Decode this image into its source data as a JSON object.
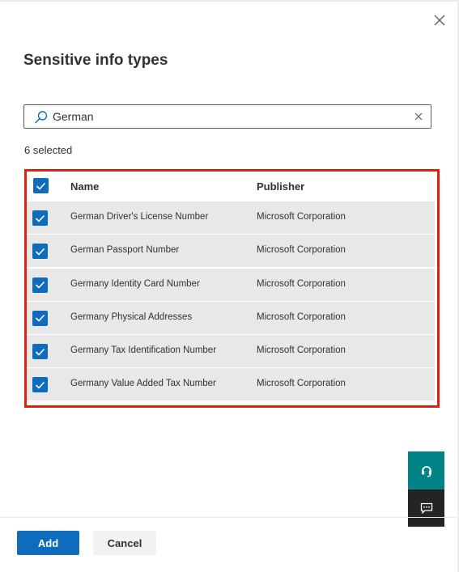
{
  "panel": {
    "title": "Sensitive info types",
    "close_icon": "close-icon"
  },
  "search": {
    "value": "German",
    "placeholder": "Search",
    "search_icon": "search-icon",
    "clear_icon": "clear-icon"
  },
  "selection": {
    "count_text": "6 selected"
  },
  "table": {
    "columns": {
      "name": "Name",
      "publisher": "Publisher"
    },
    "select_all_checked": true,
    "rows": [
      {
        "name": "German Driver's License Number",
        "publisher": "Microsoft Corporation",
        "checked": true
      },
      {
        "name": "German Passport Number",
        "publisher": "Microsoft Corporation",
        "checked": true
      },
      {
        "name": "Germany Identity Card Number",
        "publisher": "Microsoft Corporation",
        "checked": true
      },
      {
        "name": "Germany Physical Addresses",
        "publisher": "Microsoft Corporation",
        "checked": true
      },
      {
        "name": "Germany Tax Identification Number",
        "publisher": "Microsoft Corporation",
        "checked": true
      },
      {
        "name": "Germany Value Added Tax Number",
        "publisher": "Microsoft Corporation",
        "checked": true
      }
    ]
  },
  "floating": {
    "support_icon": "headset-icon",
    "feedback_icon": "chat-feedback-icon"
  },
  "footer": {
    "add_label": "Add",
    "cancel_label": "Cancel"
  },
  "colors": {
    "accent": "#0f6cbd",
    "highlight_border": "#d7230f",
    "support_teal": "#038387",
    "feedback_dark": "#252423",
    "row_background": "#e8e8e8"
  }
}
